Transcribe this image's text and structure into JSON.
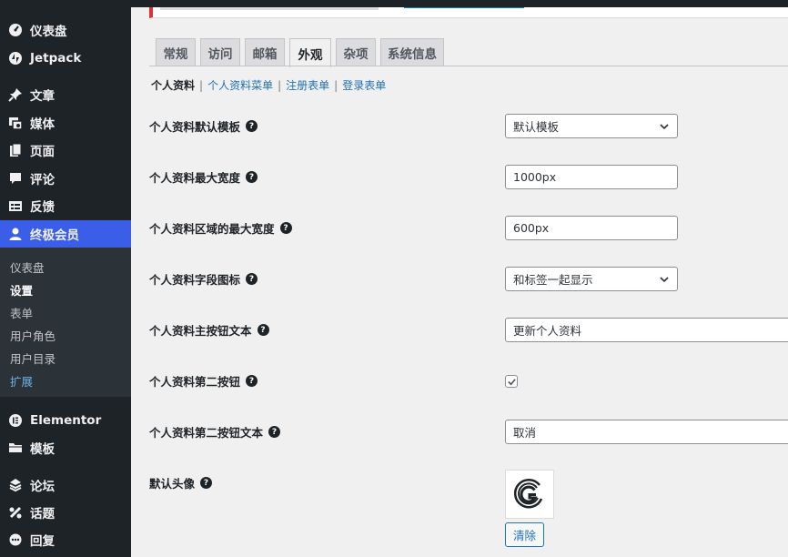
{
  "sidebar": {
    "top_items": [
      {
        "label": "仪表盘",
        "icon": "dashboard-icon"
      },
      {
        "label": "Jetpack",
        "icon": "jetpack-icon"
      },
      {
        "label": "文章",
        "icon": "pin-icon"
      },
      {
        "label": "媒体",
        "icon": "media-icon"
      },
      {
        "label": "页面",
        "icon": "pages-icon"
      },
      {
        "label": "评论",
        "icon": "comment-icon"
      },
      {
        "label": "反馈",
        "icon": "feedback-icon"
      },
      {
        "label": "终极会员",
        "icon": "user-icon"
      }
    ],
    "submenu": [
      {
        "label": "仪表盘"
      },
      {
        "label": "设置"
      },
      {
        "label": "表单"
      },
      {
        "label": "用户角色"
      },
      {
        "label": "用户目录"
      },
      {
        "label": "扩展"
      }
    ],
    "bottom_items": [
      {
        "label": "Elementor",
        "icon": "elementor-icon"
      },
      {
        "label": "模板",
        "icon": "folder-icon"
      },
      {
        "label": "论坛",
        "icon": "forum-icon"
      },
      {
        "label": "话题",
        "icon": "topic-icon"
      },
      {
        "label": "回复",
        "icon": "reply-icon"
      }
    ],
    "accent_color": "#3a5ee8"
  },
  "tabs": [
    {
      "label": "常规"
    },
    {
      "label": "访问"
    },
    {
      "label": "邮箱"
    },
    {
      "label": "外观"
    },
    {
      "label": "杂项"
    },
    {
      "label": "系统信息"
    }
  ],
  "active_tab": "外观",
  "subsub": {
    "current": "个人资料",
    "links": [
      "个人资料菜单",
      "注册表单",
      "登录表单"
    ]
  },
  "settings": {
    "template": {
      "label": "个人资料默认模板",
      "value": "默认模板"
    },
    "max_width": {
      "label": "个人资料最大宽度",
      "value": "1000px"
    },
    "area_max_width": {
      "label": "个人资料区域的最大宽度",
      "value": "600px"
    },
    "field_icons": {
      "label": "个人资料字段图标",
      "value": "和标签一起显示"
    },
    "primary_button_text": {
      "label": "个人资料主按钮文本",
      "value": "更新个人资料"
    },
    "secondary_button": {
      "label": "个人资料第二按钮",
      "checked": true
    },
    "secondary_button_text": {
      "label": "个人资料第二按钮文本",
      "value": "取消"
    },
    "default_avatar": {
      "label": "默认头像",
      "clear_label": "清除"
    }
  },
  "help_glyph": "?"
}
